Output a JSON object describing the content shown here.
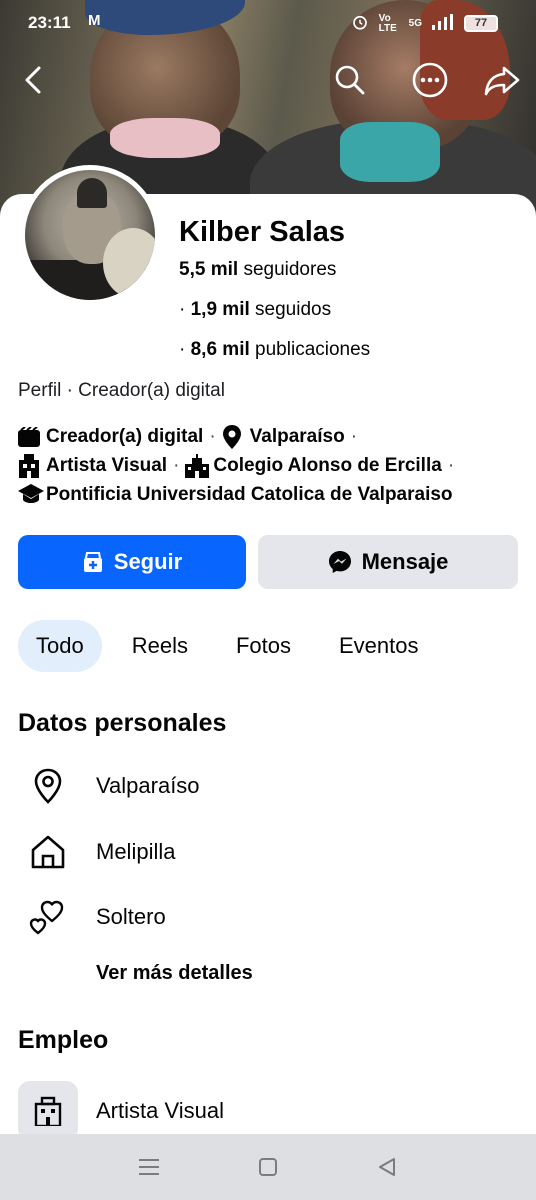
{
  "status_bar": {
    "time": "23:11",
    "mail_icon": "M",
    "network": "Vo LTE",
    "signal": "5G",
    "battery": "77"
  },
  "top_nav": {
    "back_icon": "chevron-left-icon",
    "search_icon": "search-icon",
    "more_icon": "more-icon",
    "share_icon": "share-icon"
  },
  "profile": {
    "name": "Kilber Salas",
    "followers_count": "5,5 mil",
    "followers_label": "seguidores",
    "following_prefix": "·",
    "following_count": "1,9 mil",
    "following_label": "seguidos",
    "posts_prefix": "·",
    "posts_count": "8,6 mil",
    "posts_label": "publicaciones",
    "profile_type": "Perfil · Creador(a) digital"
  },
  "details": {
    "category": "Creador(a) digital",
    "location": "Valparaíso",
    "occupation": "Artista Visual",
    "school": "Colegio Alonso de Ercilla",
    "university": "Pontificia Universidad Catolica de Valparaiso",
    "separator": "·"
  },
  "actions": {
    "follow_label": "Seguir",
    "message_label": "Mensaje"
  },
  "tabs": [
    {
      "label": "Todo",
      "active": true
    },
    {
      "label": "Reels",
      "active": false
    },
    {
      "label": "Fotos",
      "active": false
    },
    {
      "label": "Eventos",
      "active": false
    }
  ],
  "personal": {
    "title": "Datos personales",
    "city": "Valparaíso",
    "hometown": "Melipilla",
    "relationship": "Soltero",
    "more_label": "Ver más detalles"
  },
  "employment": {
    "title": "Empleo",
    "job": "Artista Visual"
  },
  "colors": {
    "primary": "#0866ff",
    "secondary_button": "#e4e6eb",
    "tab_active": "#e2eefc",
    "nav_bar": "#dedfe3"
  }
}
